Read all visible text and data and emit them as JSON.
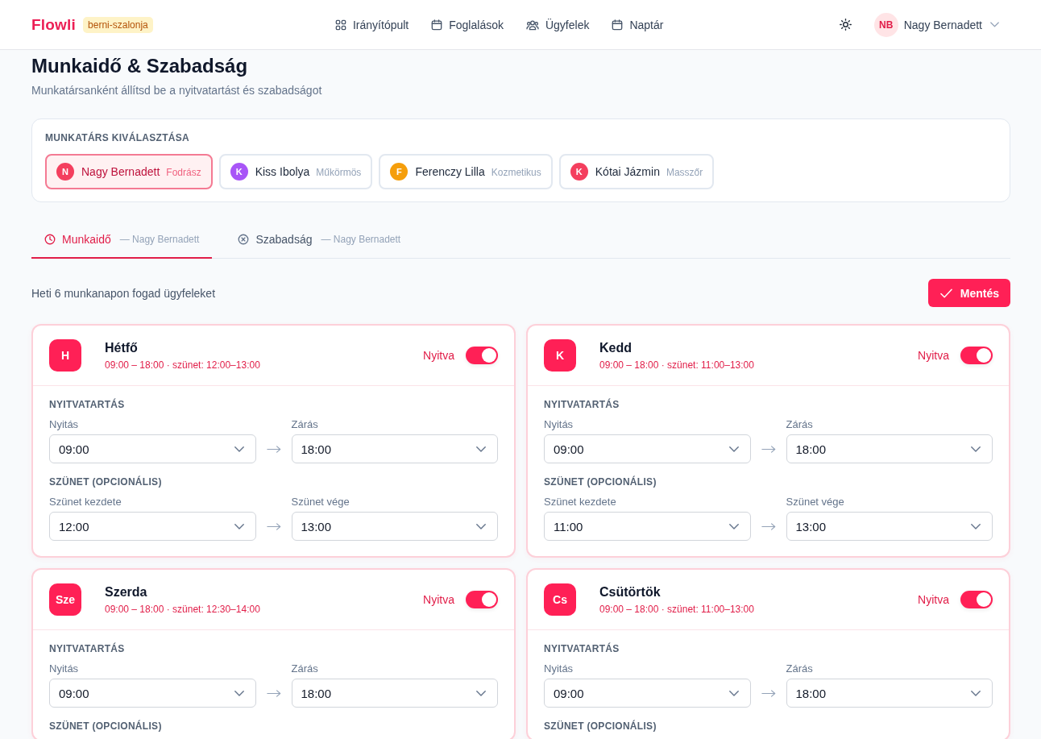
{
  "header": {
    "brand": "Flowli",
    "workspace": "berni-szalonja",
    "nav": [
      {
        "kind": "dashboard",
        "label": "Irányítópult"
      },
      {
        "kind": "bookings",
        "label": "Foglalások"
      },
      {
        "kind": "clients",
        "label": "Ügyfelek"
      },
      {
        "kind": "calendar",
        "label": "Naptár"
      }
    ],
    "user": {
      "initials": "NB",
      "name": "Nagy Bernadett"
    }
  },
  "page": {
    "title": "Munkaidő & Szabadság",
    "subtitle": "Munkatársanként állítsd be a nyitvatartást és szabadságot"
  },
  "staff_picker": {
    "label": "MUNKATÁRS KIVÁLASZTÁSA",
    "staff": [
      {
        "initial": "N",
        "name": "Nagy Bernadett",
        "role": "Fodrász",
        "color": "#f43f5e",
        "selected": true
      },
      {
        "initial": "K",
        "name": "Kiss Ibolya",
        "role": "Műkörmös",
        "color": "#a855f7",
        "selected": false
      },
      {
        "initial": "F",
        "name": "Ferenczy Lilla",
        "role": "Kozmetikus",
        "color": "#f59e0b",
        "selected": false
      },
      {
        "initial": "K",
        "name": "Kótai Jázmin",
        "role": "Masszőr",
        "color": "#f43f5e",
        "selected": false
      }
    ]
  },
  "tabs": [
    {
      "kind": "hours",
      "label": "Munkaidő",
      "detail": "— Nagy Bernadett",
      "selected": true
    },
    {
      "kind": "leave",
      "label": "Szabadság",
      "detail": "— Nagy Bernadett",
      "selected": false
    }
  ],
  "summary": "Heti 6 munkanapon fogad ügyfeleket",
  "save_button": "Mentés",
  "days": [
    {
      "initial": "H",
      "name": "Hétfő",
      "summary": "09:00 – 18:00 · szünet: 12:00–13:00",
      "status": "Nyitva",
      "open": true,
      "sections": [
        {
          "title": "NYITVATARTÁS",
          "fields": [
            {
              "label": "Nyitás",
              "value": "09:00"
            },
            {
              "label": "Zárás",
              "value": "18:00"
            }
          ]
        },
        {
          "title": "SZÜNET (OPCIONÁLIS)",
          "fields": [
            {
              "label": "Szünet kezdete",
              "value": "12:00"
            },
            {
              "label": "Szünet vége",
              "value": "13:00"
            }
          ]
        }
      ]
    },
    {
      "initial": "K",
      "name": "Kedd",
      "summary": "09:00 – 18:00 · szünet: 11:00–13:00",
      "status": "Nyitva",
      "open": true,
      "sections": [
        {
          "title": "NYITVATARTÁS",
          "fields": [
            {
              "label": "Nyitás",
              "value": "09:00"
            },
            {
              "label": "Zárás",
              "value": "18:00"
            }
          ]
        },
        {
          "title": "SZÜNET (OPCIONÁLIS)",
          "fields": [
            {
              "label": "Szünet kezdete",
              "value": "11:00"
            },
            {
              "label": "Szünet vége",
              "value": "13:00"
            }
          ]
        }
      ]
    },
    {
      "initial": "Sze",
      "name": "Szerda",
      "summary": "09:00 – 18:00 · szünet: 12:30–14:00",
      "status": "Nyitva",
      "open": true,
      "sections": [
        {
          "title": "NYITVATARTÁS",
          "fields": [
            {
              "label": "Nyitás",
              "value": "09:00"
            },
            {
              "label": "Zárás",
              "value": "18:00"
            }
          ]
        },
        {
          "title": "SZÜNET (OPCIONÁLIS)"
        }
      ]
    },
    {
      "initial": "Cs",
      "name": "Csütörtök",
      "summary": "09:00 – 18:00 · szünet: 11:00–13:00",
      "status": "Nyitva",
      "open": true,
      "sections": [
        {
          "title": "NYITVATARTÁS",
          "fields": [
            {
              "label": "Nyitás",
              "value": "09:00"
            },
            {
              "label": "Zárás",
              "value": "18:00"
            }
          ]
        },
        {
          "title": "SZÜNET (OPCIONÁLIS)"
        }
      ]
    }
  ]
}
